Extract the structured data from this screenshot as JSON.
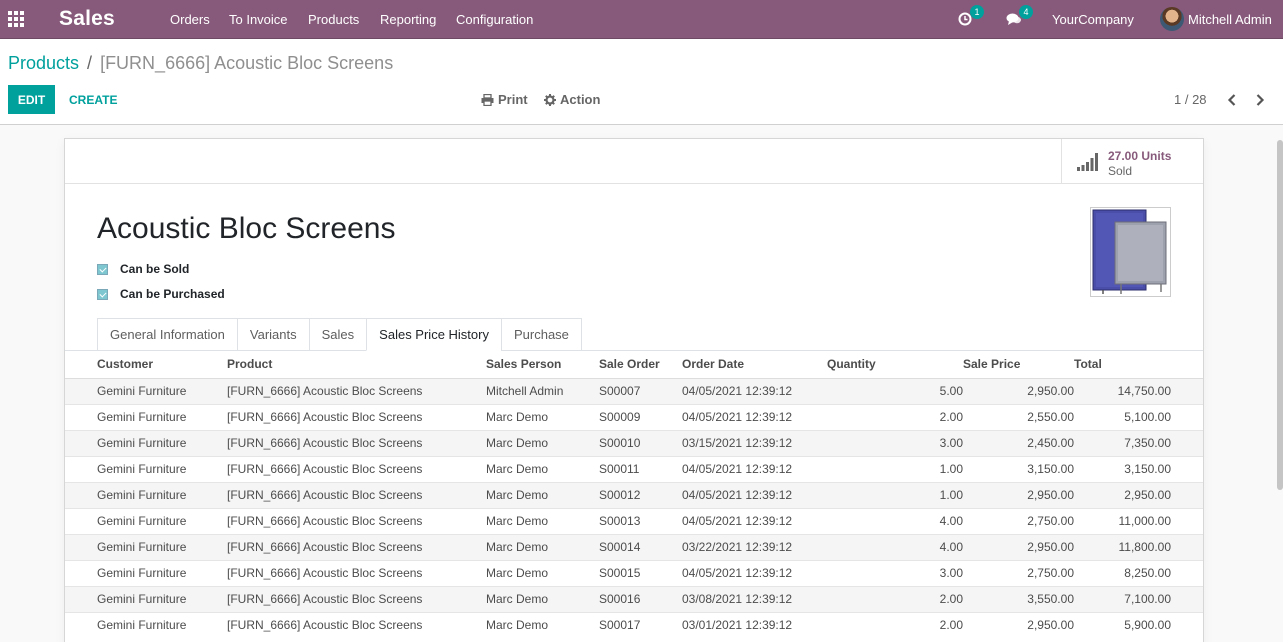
{
  "navbar": {
    "app_name": "Sales",
    "menus": [
      "Orders",
      "To Invoice",
      "Products",
      "Reporting",
      "Configuration"
    ],
    "activity_count": "1",
    "messages_count": "4",
    "company": "YourCompany",
    "user": "Mitchell Admin"
  },
  "breadcrumb": {
    "parent": "Products",
    "separator": "/",
    "current": "[FURN_6666] Acoustic Bloc Screens"
  },
  "buttons": {
    "edit": "EDIT",
    "create": "CREATE",
    "print": "Print",
    "action": "Action"
  },
  "pager": {
    "value": "1 / 28"
  },
  "stat": {
    "value": "27.00 Units",
    "label": "Sold"
  },
  "product": {
    "name": "Acoustic Bloc Screens",
    "can_be_sold_label": "Can be Sold",
    "can_be_sold": true,
    "can_be_purchased_label": "Can be Purchased",
    "can_be_purchased": true
  },
  "tabs": [
    "General Information",
    "Variants",
    "Sales",
    "Sales Price History",
    "Purchase"
  ],
  "active_tab": "Sales Price History",
  "table": {
    "headers": [
      "Customer",
      "Product",
      "Sales Person",
      "Sale Order",
      "Order Date",
      "Quantity",
      "Sale Price",
      "Total"
    ],
    "rows": [
      [
        "Gemini Furniture",
        "[FURN_6666] Acoustic Bloc Screens",
        "Mitchell Admin",
        "S00007",
        "04/05/2021 12:39:12",
        "5.00",
        "2,950.00",
        "14,750.00"
      ],
      [
        "Gemini Furniture",
        "[FURN_6666] Acoustic Bloc Screens",
        "Marc Demo",
        "S00009",
        "04/05/2021 12:39:12",
        "2.00",
        "2,550.00",
        "5,100.00"
      ],
      [
        "Gemini Furniture",
        "[FURN_6666] Acoustic Bloc Screens",
        "Marc Demo",
        "S00010",
        "03/15/2021 12:39:12",
        "3.00",
        "2,450.00",
        "7,350.00"
      ],
      [
        "Gemini Furniture",
        "[FURN_6666] Acoustic Bloc Screens",
        "Marc Demo",
        "S00011",
        "04/05/2021 12:39:12",
        "1.00",
        "3,150.00",
        "3,150.00"
      ],
      [
        "Gemini Furniture",
        "[FURN_6666] Acoustic Bloc Screens",
        "Marc Demo",
        "S00012",
        "04/05/2021 12:39:12",
        "1.00",
        "2,950.00",
        "2,950.00"
      ],
      [
        "Gemini Furniture",
        "[FURN_6666] Acoustic Bloc Screens",
        "Marc Demo",
        "S00013",
        "04/05/2021 12:39:12",
        "4.00",
        "2,750.00",
        "11,000.00"
      ],
      [
        "Gemini Furniture",
        "[FURN_6666] Acoustic Bloc Screens",
        "Marc Demo",
        "S00014",
        "03/22/2021 12:39:12",
        "4.00",
        "2,950.00",
        "11,800.00"
      ],
      [
        "Gemini Furniture",
        "[FURN_6666] Acoustic Bloc Screens",
        "Marc Demo",
        "S00015",
        "04/05/2021 12:39:12",
        "3.00",
        "2,750.00",
        "8,250.00"
      ],
      [
        "Gemini Furniture",
        "[FURN_6666] Acoustic Bloc Screens",
        "Marc Demo",
        "S00016",
        "03/08/2021 12:39:12",
        "2.00",
        "3,550.00",
        "7,100.00"
      ],
      [
        "Gemini Furniture",
        "[FURN_6666] Acoustic Bloc Screens",
        "Marc Demo",
        "S00017",
        "03/01/2021 12:39:12",
        "2.00",
        "2,950.00",
        "5,900.00"
      ]
    ]
  },
  "icons": {
    "apps": "apps-grid-icon",
    "activity": "clock-icon",
    "messages": "chat-bubbles-icon",
    "print": "print-icon",
    "action": "gear-icon",
    "prev": "chevron-left-icon",
    "next": "chevron-right-icon",
    "stat": "signal-bars-icon"
  },
  "colors": {
    "navbar": "#875a7b",
    "accent": "#00a09d",
    "stat_value": "#875a7b"
  }
}
